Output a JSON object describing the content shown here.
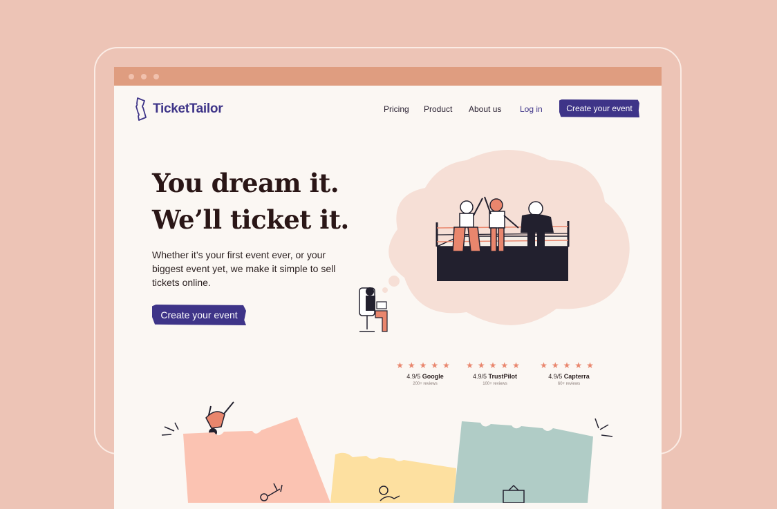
{
  "brand": {
    "logo_text": "TicketTailor"
  },
  "nav": {
    "items": [
      "Pricing",
      "Product",
      "About us"
    ],
    "login": "Log in",
    "cta": "Create your event"
  },
  "hero": {
    "headline_line1": "You dream it.",
    "headline_line2": "We’ll ticket it.",
    "subtext": "Whether it’s your first event ever, or your biggest event yet, we make it simple to sell tickets online.",
    "cta": "Create your event"
  },
  "ratings": [
    {
      "stars": "★★★★★",
      "score": "4.9/5",
      "source": "Google",
      "count": "200+ reviews"
    },
    {
      "stars": "★★★★★",
      "score": "4.9/5",
      "source": "TrustPilot",
      "count": "100+ reviews"
    },
    {
      "stars": "★★★★★",
      "score": "4.9/5",
      "source": "Capterra",
      "count": "60+ reviews"
    }
  ],
  "colors": {
    "background": "#edc4b6",
    "browser_bar": "#df9d80",
    "page": "#fbf7f3",
    "brand": "#3e3488",
    "star": "#e9866d",
    "ticket_pink": "#fbc3b2",
    "ticket_yellow": "#fde0a0",
    "ticket_teal": "#b0ccc6"
  },
  "icons": [
    "ticket-logo-icon",
    "boxing-ring-illustration",
    "desk-person-illustration",
    "breakdancer-illustration"
  ]
}
